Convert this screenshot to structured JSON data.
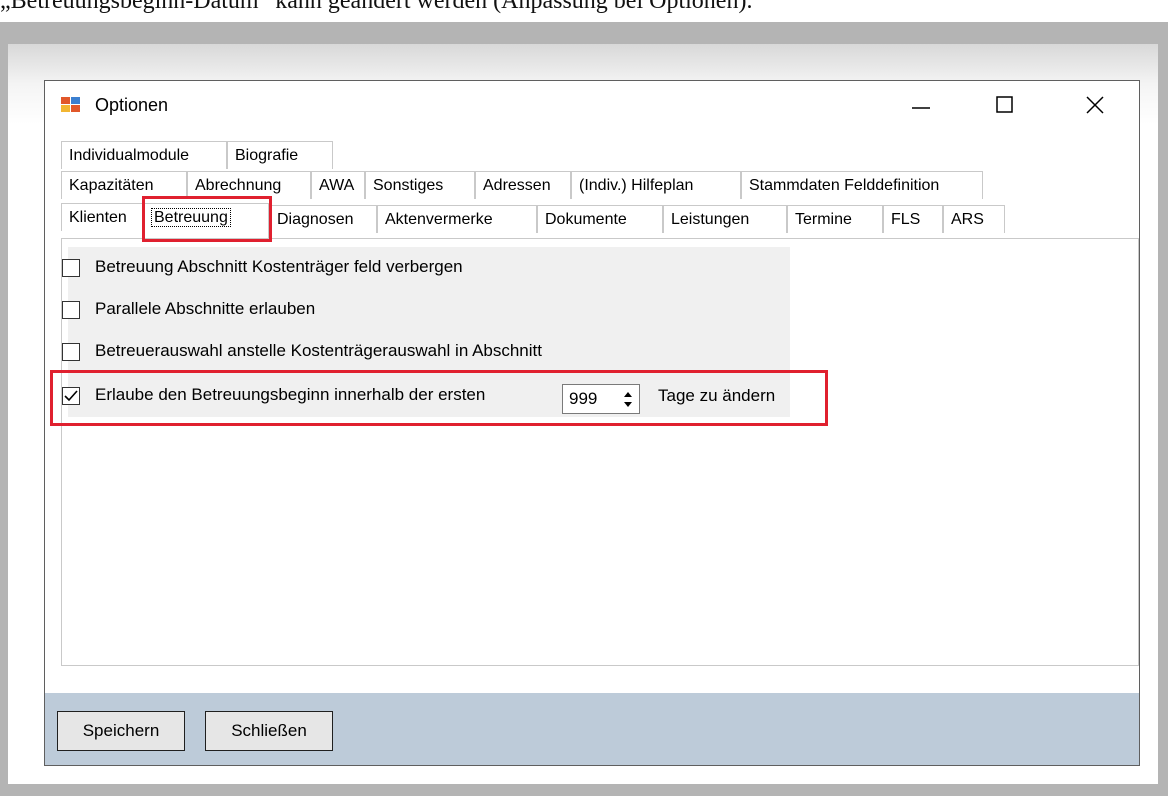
{
  "caption": "„Betreuungsbeginn-Datum“ kann geändert werden (Anpassung bei Optionen).",
  "window": {
    "title": "Optionen",
    "controls": {
      "minimize": "minimize-icon",
      "maximize": "maximize-icon",
      "close": "close-icon"
    }
  },
  "tabs": {
    "row1": [
      "Individualmodule",
      "Biografie"
    ],
    "row2": [
      "Kapazitäten",
      "Abrechnung",
      "AWA",
      "Sonstiges",
      "Adressen",
      "(Indiv.) Hilfeplan",
      "Stammdaten Felddefinition"
    ],
    "row3": [
      "Klienten",
      "Betreuung",
      "Diagnosen",
      "Aktenvermerke",
      "Dokumente",
      "Leistungen",
      "Termine",
      "FLS",
      "ARS"
    ],
    "selected": "Betreuung"
  },
  "options": [
    {
      "label": "Betreuung Abschnitt Kostenträger feld verbergen",
      "checked": false
    },
    {
      "label": "Parallele Abschnitte erlauben",
      "checked": false
    },
    {
      "label": "Betreuerauswahl anstelle Kostenträgerauswahl in Abschnitt",
      "checked": false
    },
    {
      "label": "Erlaube den Betreuungsbeginn innerhalb der ersten",
      "checked": true
    }
  ],
  "days_spinner": {
    "value": "999",
    "suffix": "Tage zu ändern"
  },
  "footer": {
    "save_label": "Speichern",
    "close_label": "Schließen"
  },
  "colors": {
    "highlight": "#e0202f",
    "footer_bg": "#bdcbd9",
    "panel_bg": "#f0f0f0"
  }
}
